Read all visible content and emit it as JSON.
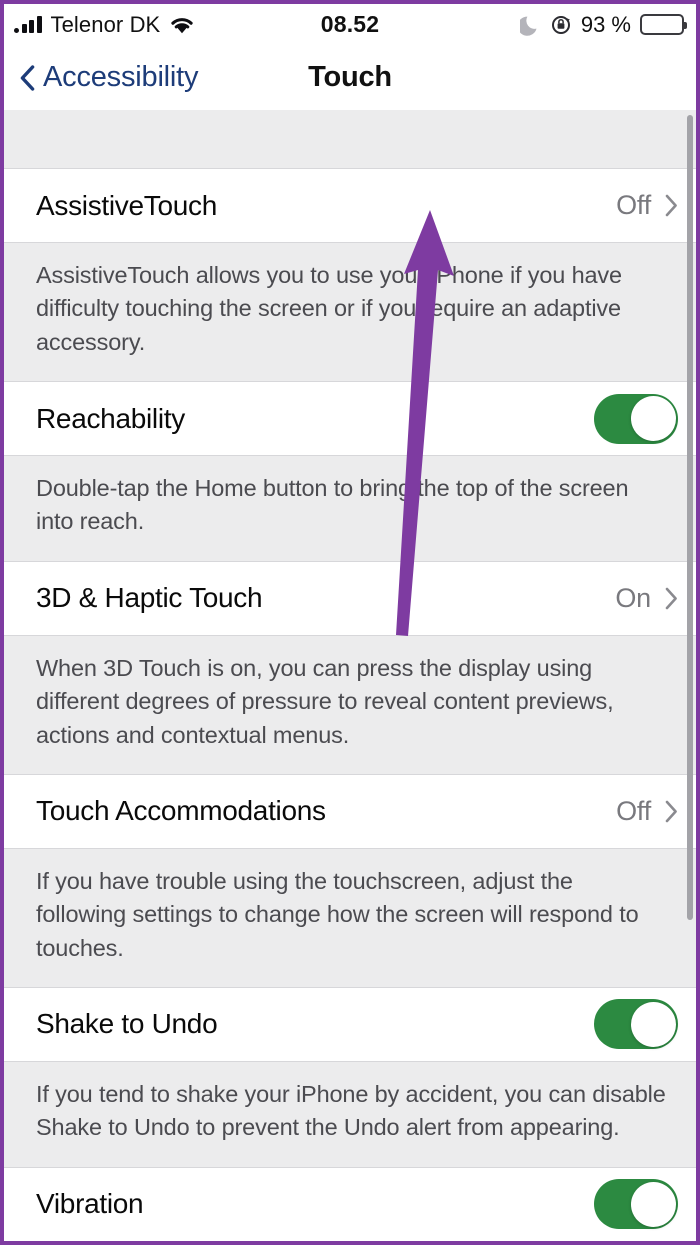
{
  "status_bar": {
    "signal_icon": "cellular-signal-icon",
    "carrier": "Telenor DK",
    "wifi_icon": "wifi-icon",
    "time": "08.52",
    "dnd_icon": "moon-do-not-disturb-icon",
    "rotation_lock_icon": "rotation-lock-icon",
    "battery_percent": "93 %",
    "battery_icon": "battery-low-power-icon",
    "battery_color": "#b5650b"
  },
  "nav_bar": {
    "back_icon": "chevron-left-icon",
    "back_label": "Accessibility",
    "title": "Touch",
    "back_color": "#1d3c79"
  },
  "colors": {
    "toggle_on": "#2c8a41",
    "annotation": "#7e3ba1",
    "border": "#7e3ba1",
    "group_background": "#ececed",
    "row_background": "#ffffff"
  },
  "sections": [
    {
      "type": "disclosure",
      "label": "AssistiveTouch",
      "value": "Off",
      "chevron_icon": "chevron-right-icon",
      "footer": "AssistiveTouch allows you to use your iPhone if you have difficulty touching the screen or if you require an adaptive accessory."
    },
    {
      "type": "toggle",
      "label": "Reachability",
      "toggle_state": "on",
      "footer": "Double-tap the Home button to bring the top of the screen into reach."
    },
    {
      "type": "disclosure",
      "label": "3D & Haptic Touch",
      "value": "On",
      "chevron_icon": "chevron-right-icon",
      "footer": "When 3D Touch is on, you can press the display using different degrees of pressure to reveal content previews, actions and contextual menus."
    },
    {
      "type": "disclosure",
      "label": "Touch Accommodations",
      "value": "Off",
      "chevron_icon": "chevron-right-icon",
      "footer": "If you have trouble using the touchscreen, adjust the following settings to change how the screen will respond to touches."
    },
    {
      "type": "toggle",
      "label": "Shake to Undo",
      "toggle_state": "on",
      "footer": "If you tend to shake your iPhone by accident, you can disable Shake to Undo to prevent the Undo alert from appearing."
    },
    {
      "type": "toggle",
      "label": "Vibration",
      "toggle_state": "on",
      "footer": ""
    }
  ],
  "annotation": {
    "type": "arrow",
    "points_at": "AssistiveTouch"
  },
  "scrollbar": {
    "name": "vertical-scrollbar"
  }
}
